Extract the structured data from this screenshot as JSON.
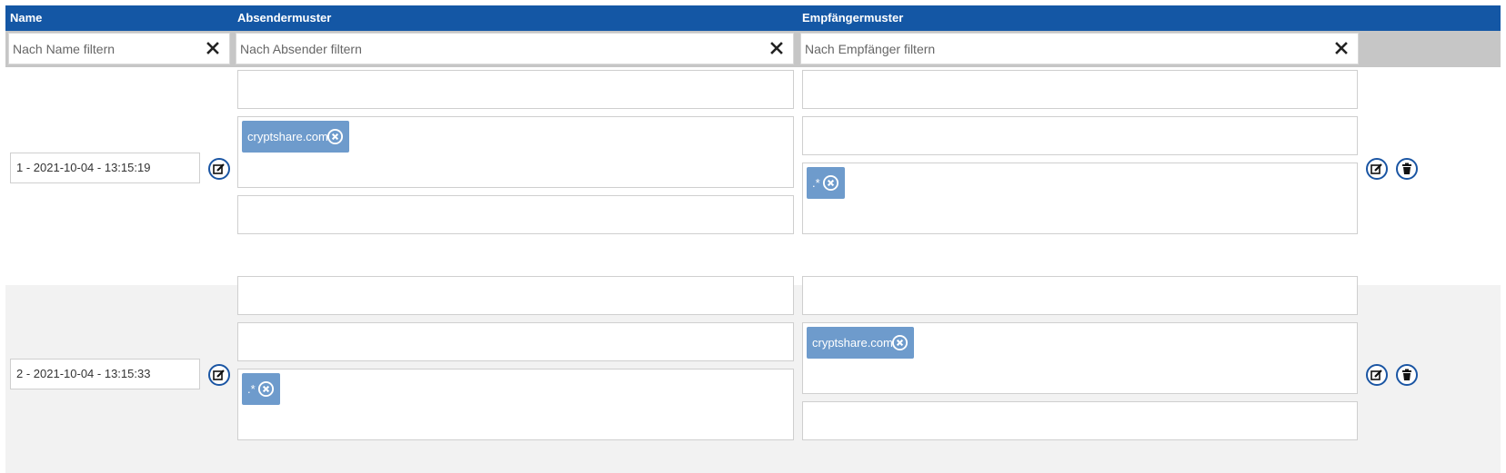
{
  "columns": {
    "name": "Name",
    "sender": "Absendermuster",
    "recipient": "Empfängermuster"
  },
  "filters": {
    "name_placeholder": "Nach Name filtern",
    "sender_placeholder": "Nach Absender filtern",
    "recipient_placeholder": "Nach Empfänger filtern"
  },
  "rows": [
    {
      "name": "1 - 2021-10-04 - 13:15:19",
      "sender_chip": "cryptshare.com",
      "recipient_chip": ".*"
    },
    {
      "name": "2 - 2021-10-04 - 13:15:33",
      "sender_chip": ".*",
      "recipient_chip": "cryptshare.com"
    }
  ],
  "icons": {
    "clear": "close-icon",
    "edit": "edit-icon",
    "delete": "trash-icon",
    "chip_remove": "remove-circle-icon"
  },
  "colors": {
    "header": "#1457a5",
    "chip": "#6e9bcc",
    "icon_ring": "#1a55a3",
    "filter_bar": "#c6c6c6",
    "alt_row": "#f2f2f2"
  }
}
